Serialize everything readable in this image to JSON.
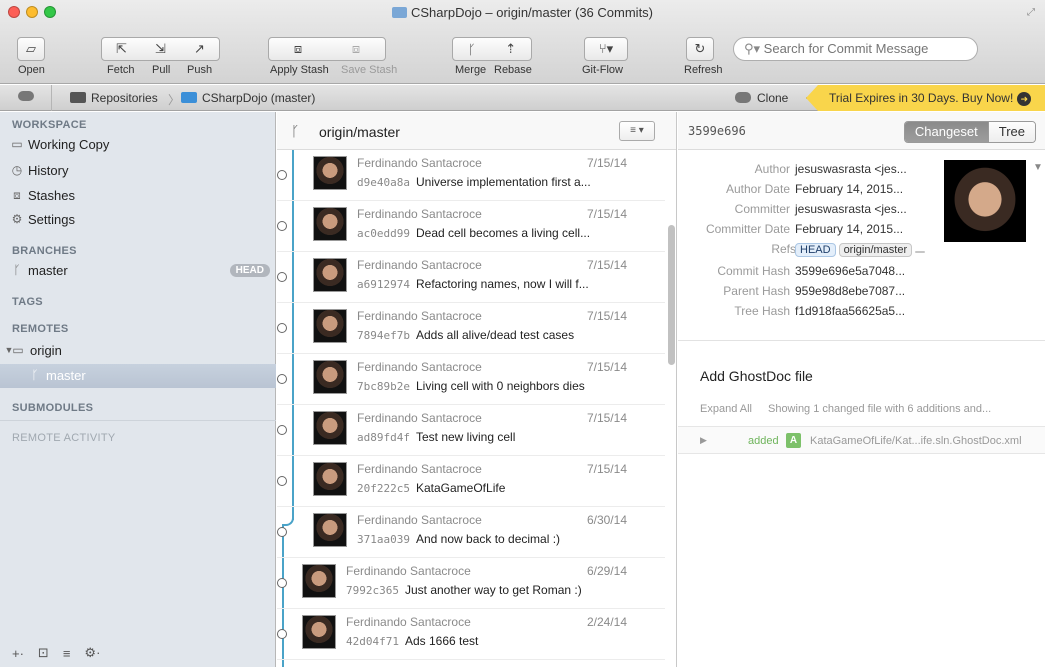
{
  "window": {
    "title": "CSharpDojo – origin/master (36 Commits)"
  },
  "toolbar": {
    "open": "Open",
    "fetch": "Fetch",
    "pull": "Pull",
    "push": "Push",
    "apply_stash": "Apply Stash",
    "save_stash": "Save Stash",
    "merge": "Merge",
    "rebase": "Rebase",
    "git_flow": "Git-Flow",
    "refresh": "Refresh",
    "search_placeholder": "Search for Commit Message"
  },
  "breadcrumb": {
    "repositories": "Repositories",
    "repo": "CSharpDojo (master)",
    "clone": "Clone",
    "trial": "Trial Expires in 30 Days. Buy Now!"
  },
  "sidebar": {
    "workspace": "WORKSPACE",
    "working_copy": "Working Copy",
    "history": "History",
    "stashes": "Stashes",
    "settings": "Settings",
    "branches": "BRANCHES",
    "master": "master",
    "head_badge": "HEAD",
    "tags": "TAGS",
    "remotes": "REMOTES",
    "origin": "origin",
    "origin_master": "master",
    "submodules": "SUBMODULES",
    "remote_activity": "REMOTE ACTIVITY"
  },
  "commit_list": {
    "branch": "origin/master",
    "commits": [
      {
        "author": "Ferdinando Santacroce",
        "date": "7/15/14",
        "hash": "d9e40a8a",
        "message": "Universe implementation first a..."
      },
      {
        "author": "Ferdinando Santacroce",
        "date": "7/15/14",
        "hash": "ac0edd99",
        "message": "Dead cell becomes a living cell..."
      },
      {
        "author": "Ferdinando Santacroce",
        "date": "7/15/14",
        "hash": "a6912974",
        "message": "Refactoring names, now I will f..."
      },
      {
        "author": "Ferdinando Santacroce",
        "date": "7/15/14",
        "hash": "7894ef7b",
        "message": "Adds all alive/dead test cases"
      },
      {
        "author": "Ferdinando Santacroce",
        "date": "7/15/14",
        "hash": "7bc89b2e",
        "message": "Living cell with 0 neighbors dies"
      },
      {
        "author": "Ferdinando Santacroce",
        "date": "7/15/14",
        "hash": "ad89fd4f",
        "message": "Test new living cell"
      },
      {
        "author": "Ferdinando Santacroce",
        "date": "7/15/14",
        "hash": "20f222c5",
        "message": "KataGameOfLife"
      },
      {
        "author": "Ferdinando Santacroce",
        "date": "6/30/14",
        "hash": "371aa039",
        "message": "And now back to decimal :)"
      },
      {
        "author": "Ferdinando Santacroce",
        "date": "6/29/14",
        "hash": "7992c365",
        "message": "Just another way to get Roman :)"
      },
      {
        "author": "Ferdinando Santacroce",
        "date": "2/24/14",
        "hash": "42d04f71",
        "message": "Ads 1666 test"
      }
    ]
  },
  "detail": {
    "sha": "3599e696",
    "tab_changeset": "Changeset",
    "tab_tree": "Tree",
    "author_k": "Author",
    "author_v": "jesuswasrasta <jes...",
    "author_date_k": "Author Date",
    "author_date_v": "February 14, 2015...",
    "committer_k": "Committer",
    "committer_v": "jesuswasrasta <jes...",
    "committer_date_k": "Committer Date",
    "committer_date_v": "February 14, 2015...",
    "refs_k": "Refs",
    "ref_head": "HEAD",
    "ref_origin": "origin/master",
    "commit_hash_k": "Commit Hash",
    "commit_hash_v": "3599e696e5a7048...",
    "parent_hash_k": "Parent Hash",
    "parent_hash_v": "959e98d8ebe7087...",
    "tree_hash_k": "Tree Hash",
    "tree_hash_v": "f1d918faa56625a5...",
    "subject": "Add GhostDoc file",
    "expand_all": "Expand All",
    "summary": "Showing 1 changed file with 6 additions and...",
    "file_status": "added",
    "file_badge": "A",
    "file_path": "KataGameOfLife/Kat...ife.sln.GhostDoc.xml"
  }
}
